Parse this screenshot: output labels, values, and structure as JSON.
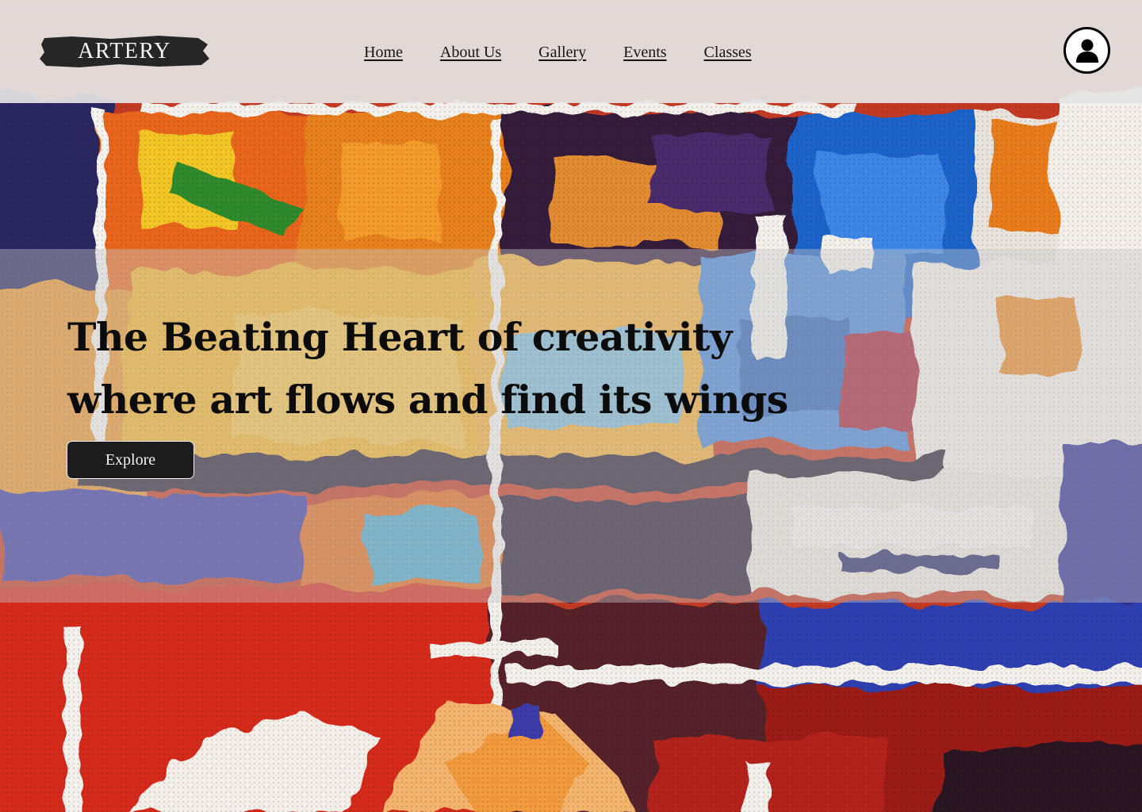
{
  "header": {
    "logo_text": "ARTERY",
    "nav": [
      {
        "label": "Home"
      },
      {
        "label": "About Us"
      },
      {
        "label": "Gallery"
      },
      {
        "label": "Events"
      },
      {
        "label": "Classes"
      }
    ],
    "profile_icon": "user-icon"
  },
  "hero": {
    "title_line1": "The Beating Heart of creativity",
    "title_line2": "where art flows and find its wings",
    "cta_label": "Explore"
  },
  "colors": {
    "header_bg": "#e4e4e4",
    "button_bg": "#1c1c1c",
    "text": "#0c0c0c"
  }
}
